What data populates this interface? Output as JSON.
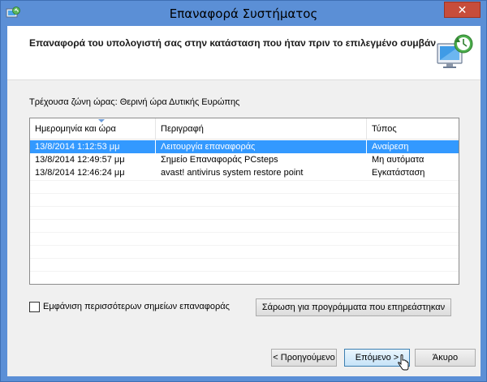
{
  "window": {
    "title": "Επαναφορά Συστήματος",
    "close_label": "✕"
  },
  "header": {
    "text": "Επαναφορά του υπολογιστή σας στην κατάσταση που ήταν πριν το επιλεγμένο συμβάν"
  },
  "timezone_label": "Τρέχουσα ζώνη ώρας: Θερινή ώρα Δυτικής Ευρώπης",
  "table": {
    "columns": [
      "Ημερομηνία και ώρα",
      "Περιγραφή",
      "Τύπος"
    ],
    "rows": [
      {
        "date": "13/8/2014 1:12:53 μμ",
        "description": "Λειτουργία επαναφοράς",
        "type": "Αναίρεση",
        "selected": true
      },
      {
        "date": "13/8/2014 12:49:57 μμ",
        "description": "Σημείο Επαναφοράς PCsteps",
        "type": "Μη αυτόματα",
        "selected": false
      },
      {
        "date": "13/8/2014 12:46:24 μμ",
        "description": "avast! antivirus system restore point",
        "type": "Εγκατάσταση",
        "selected": false
      }
    ]
  },
  "options": {
    "show_more_label": "Εμφάνιση περισσότερων σημείων επαναφοράς",
    "show_more_checked": false
  },
  "buttons": {
    "scan": "Σάρωση για προγράμματα που επηρεάστηκαν",
    "back": "< Προηγούμενο",
    "next": "Επόμενο >",
    "cancel": "Άκυρο"
  },
  "colors": {
    "titlebar": "#5b8fd6",
    "selection": "#3399ff",
    "close": "#c74d3b"
  }
}
